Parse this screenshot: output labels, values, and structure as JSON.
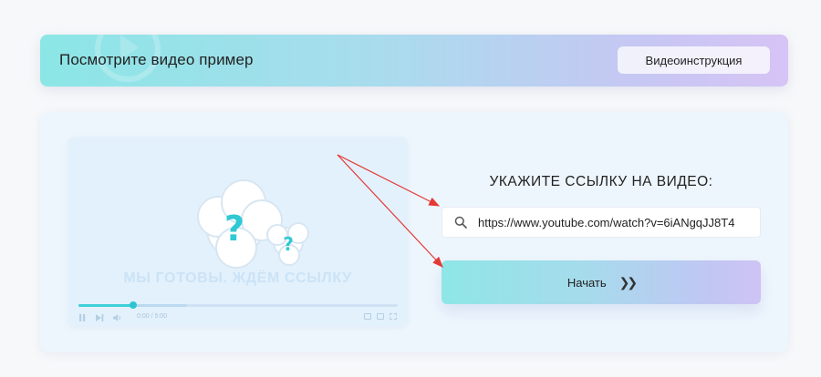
{
  "banner": {
    "title": "Посмотрите видео пример",
    "button_label": "Видеоинструкция"
  },
  "player": {
    "caption": "МЫ ГОТОВЫ. ЖДЁМ ССЫЛКУ",
    "time": "0:00 / 5:00",
    "progress": 0.17
  },
  "form": {
    "instruction": "УКАЖИТЕ ССЫЛКУ НА ВИДЕО:",
    "url_value": "https://www.youtube.com/watch?v=6iANgqJJ8T4",
    "start_label": "Начать",
    "start_icon": "double-chevron-right"
  },
  "colors": {
    "accent_teal": "#3fd0d8",
    "arrow_red": "#e53935"
  }
}
